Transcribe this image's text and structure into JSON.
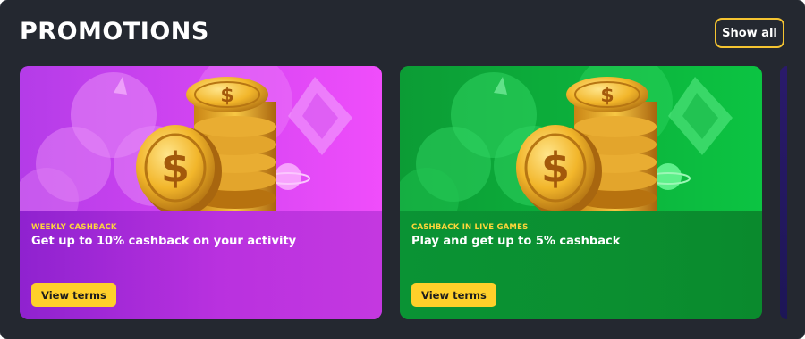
{
  "header": {
    "title": "PROMOTIONS",
    "show_all_label": "Show all"
  },
  "promotions": [
    {
      "tag": "WEEKLY CASHBACK",
      "text": "Get up to 10% cashback on your activity",
      "button_label": "View terms",
      "theme": "purple",
      "accent": "#d844f2",
      "art_icon": "gold-coins-icon"
    },
    {
      "tag": "CASHBACK IN LIVE GAMES",
      "text": "Play and get up to 5% cashback",
      "button_label": "View terms",
      "theme": "green",
      "accent": "#0d9a36",
      "art_icon": "gold-coins-icon"
    }
  ],
  "colors": {
    "background": "#242830",
    "tag_yellow": "#ffd73a",
    "button_yellow": "#ffd02a",
    "show_all_border": "#f5c431"
  }
}
